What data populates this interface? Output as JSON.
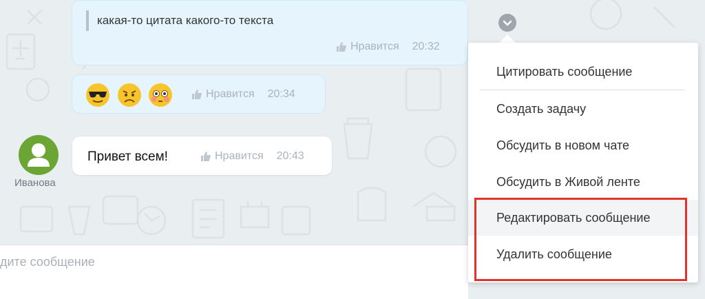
{
  "messages": [
    {
      "quote": "какая-то цитата какого-то текста",
      "like": "Нравится",
      "time": "20:32"
    },
    {
      "emojis": [
        "cool-face",
        "sad-face",
        "blushing-face"
      ],
      "like": "Нравится",
      "time": "20:34"
    },
    {
      "text": "Привет всем!",
      "like": "Нравится",
      "time": "20:43",
      "author": "Иванова"
    }
  ],
  "menu": {
    "items": [
      "Цитировать сообщение",
      "Создать задачу",
      "Обсудить в новом чате",
      "Обсудить в Живой ленте",
      "Редактировать сообщение",
      "Удалить сообщение"
    ]
  },
  "input": {
    "placeholder": "дите сообщение"
  },
  "colors": {
    "accent": "#e5312b",
    "avatar": "#6ba534",
    "bubble": "#e6f5fd"
  }
}
